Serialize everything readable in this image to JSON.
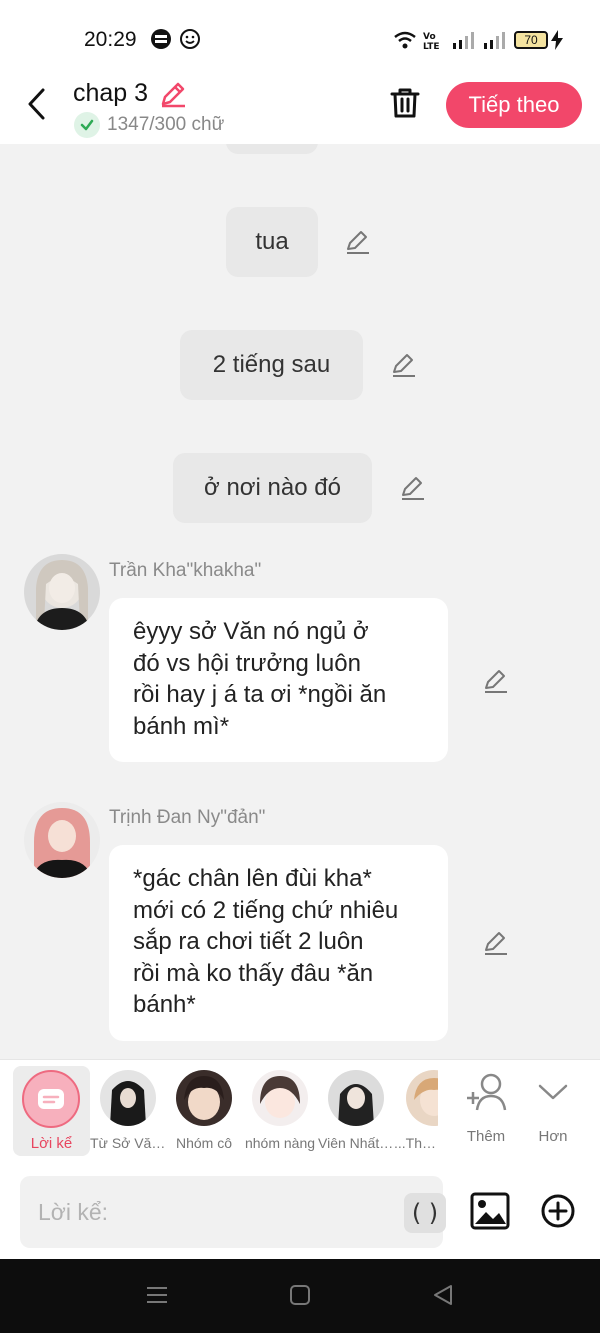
{
  "status_bar": {
    "time": "20:29",
    "battery": "70",
    "icons": [
      "baomoi-app-icon",
      "smiley-icon",
      "wifi-icon",
      "volte-icon",
      "signal-icon",
      "signal-icon",
      "battery-icon",
      "charging-icon"
    ]
  },
  "header": {
    "title": "chap 3",
    "word_count": "1347/300 chữ",
    "next_label": "Tiếp theo",
    "accent_color": "#f2476a"
  },
  "messages": [
    {
      "type": "narration",
      "text": "tua"
    },
    {
      "type": "narration",
      "text": "2 tiếng sau"
    },
    {
      "type": "narration",
      "text": "ở nơi nào đó"
    },
    {
      "type": "dialogue",
      "name": "Trần Kha\"khakha\"",
      "lines": [
        "êyyy sở Văn nó ngủ ở",
        "đó vs hội trưởng luôn",
        "rồi hay j á ta ơi *ngồi ăn",
        "bánh mì*"
      ]
    },
    {
      "type": "dialogue",
      "name": "Trịnh Đan Ny\"đản\"",
      "lines": [
        "*gác chân lên đùi kha*",
        "mới có 2 tiếng chứ nhiêu",
        "sắp ra chơi tiết 2 luôn",
        "rồi mà ko thấy đâu *ăn",
        "bánh*"
      ]
    }
  ],
  "character_bar": {
    "narration_label": "Lời kể",
    "characters": [
      {
        "label": "Từ Sở Văn..."
      },
      {
        "label": "Nhóm cô"
      },
      {
        "label": "nhóm nàng"
      },
      {
        "label": "Viên Nhất ..."
      },
      {
        "label": "...Thẩm"
      }
    ],
    "add_label": "Thêm",
    "more_label": "Hơn"
  },
  "input": {
    "placeholder": "Lời kể:",
    "value": "",
    "paren_button": "( )"
  }
}
